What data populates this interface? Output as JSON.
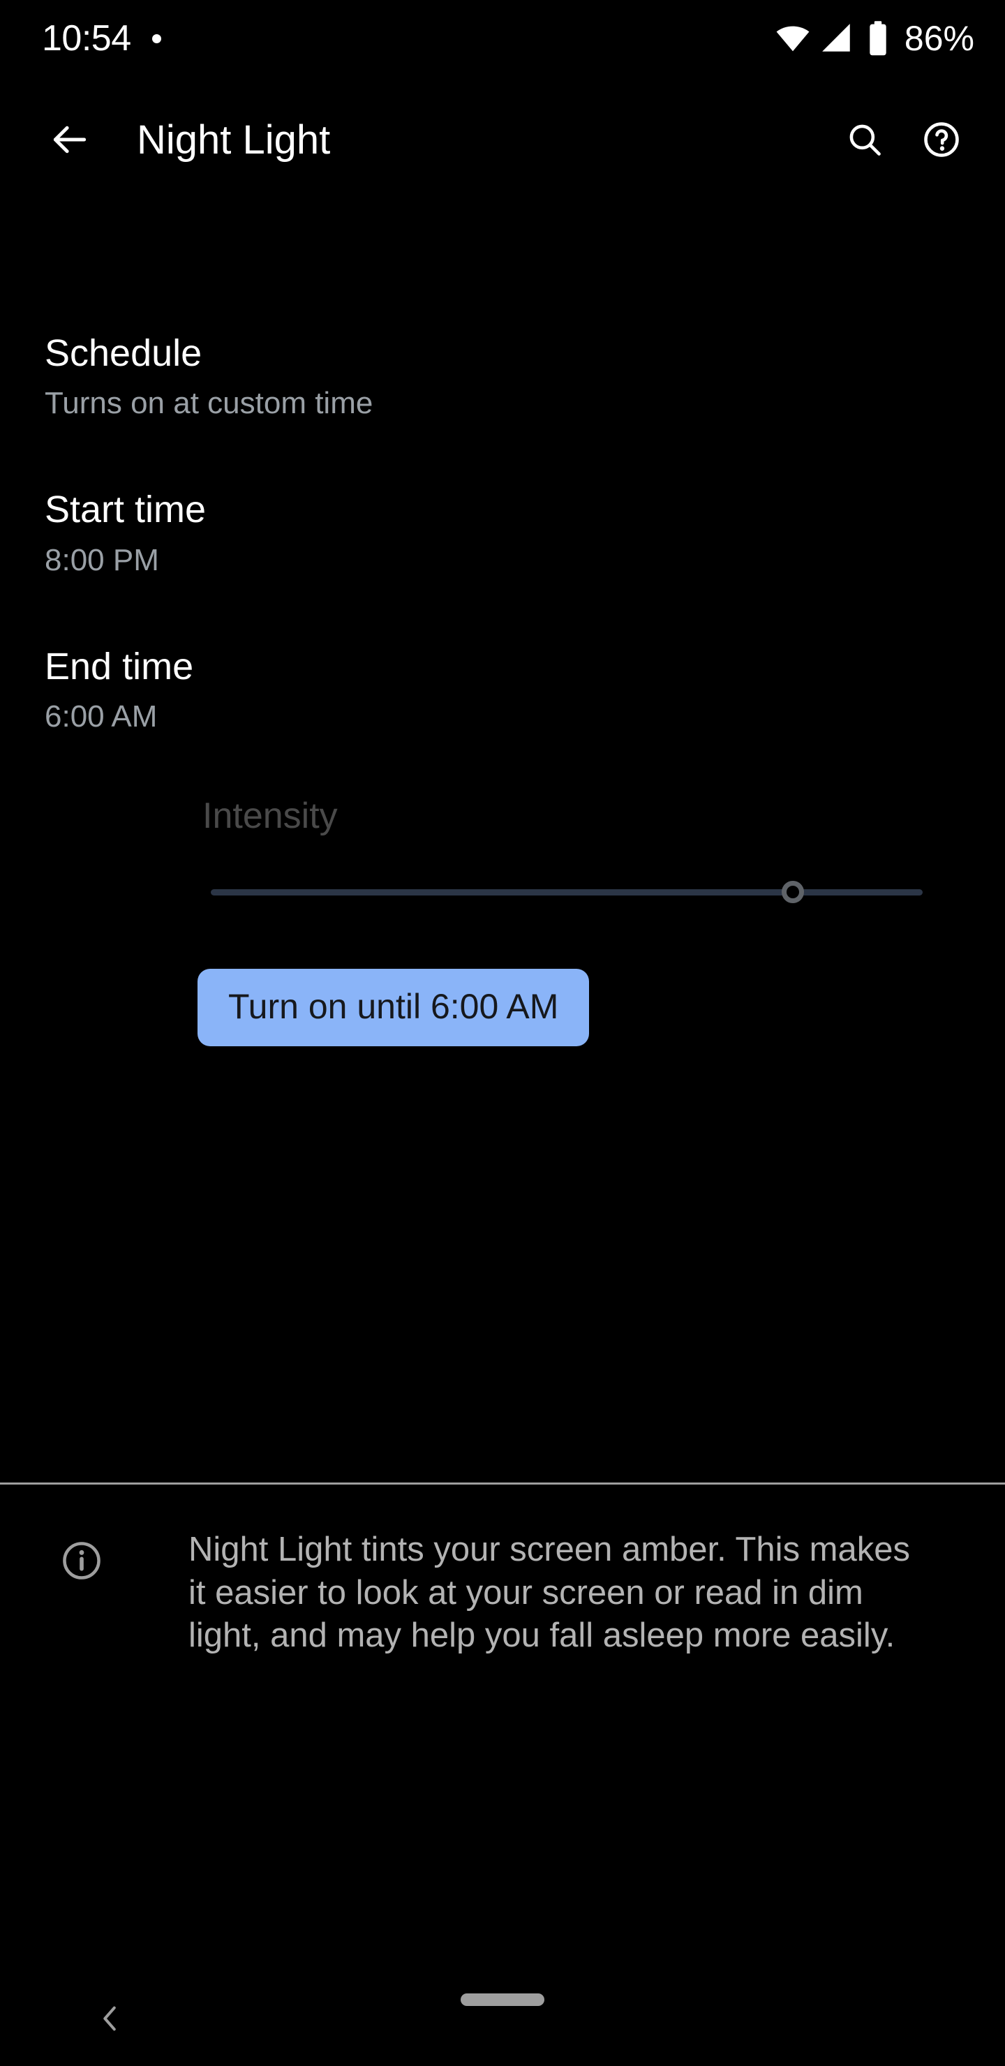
{
  "status_bar": {
    "time": "10:54",
    "notification_dot": "notification-dot",
    "wifi_icon": "wifi-icon",
    "signal_icon": "cellular-signal-icon",
    "battery_icon": "battery-icon",
    "battery_percent": "86%"
  },
  "app_bar": {
    "back_icon": "arrow-back-icon",
    "title": "Night Light",
    "search_icon": "search-icon",
    "help_icon": "help-circle-icon"
  },
  "preferences": [
    {
      "key": "schedule",
      "title": "Schedule",
      "summary": "Turns on at custom time"
    },
    {
      "key": "start_time",
      "title": "Start time",
      "summary": "8:00 PM"
    },
    {
      "key": "end_time",
      "title": "End time",
      "summary": "6:00 AM"
    }
  ],
  "intensity": {
    "label": "Intensity",
    "value_percent": 82,
    "enabled": false,
    "track_color": "#2b3546",
    "thumb_color": "#5f6368"
  },
  "turn_on": {
    "label": "Turn on until 6:00 AM",
    "background_color": "#8ab4f8",
    "text_color": "#16181c"
  },
  "footer": {
    "info_icon": "info-circle-icon",
    "text": "Night Light tints your screen amber. This makes it easier to look at your screen or read in dim light, and may help you fall asleep more easily."
  },
  "nav_bar": {
    "back_icon": "chevron-back-icon",
    "home_handle": "gesture-home-handle"
  }
}
